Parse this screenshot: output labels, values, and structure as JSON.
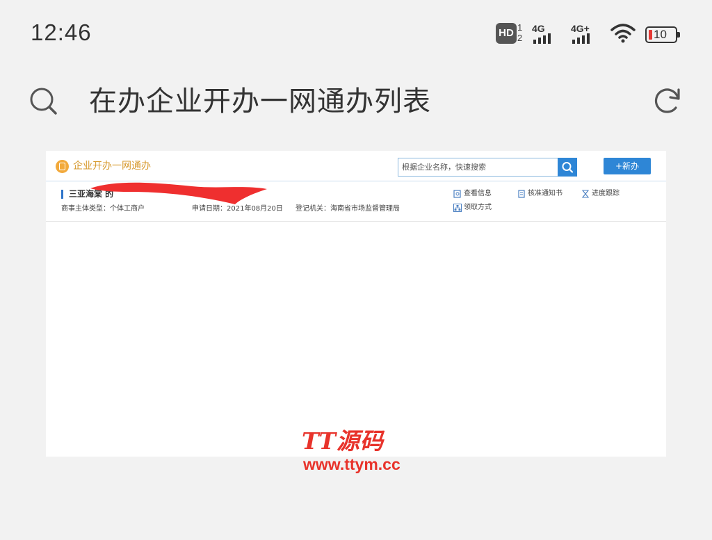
{
  "status_bar": {
    "time": "12:46",
    "hd_label": "HD",
    "hd_sim_top": "1",
    "hd_sim_bottom": "2",
    "sim1_label": "4G",
    "sim2_label": "4G+",
    "battery_level": "10",
    "battery_color": "#e53935"
  },
  "browser": {
    "title": "在办企业开办一网通办列表",
    "search_icon": "search-icon",
    "reload_icon": "reload-icon"
  },
  "webpage": {
    "logo_text": "企业开办一网通办",
    "search_placeholder": "根据企业名称，快速搜索",
    "new_button_label": "+新办",
    "accent_color": "#2e86d6",
    "record": {
      "company_name": "三亚海棠 的",
      "entity_type": "商事主体类型：个体工商户",
      "apply_date": "申请日期：2021年08月20日",
      "registry": "登记机关：海南省市场监督管理局",
      "actions": {
        "view_info": "查看信息",
        "approval_notice": "核准通知书",
        "progress": "进度跟踪",
        "pickup": "领取方式"
      }
    }
  },
  "watermark": {
    "title": "TT源码",
    "url": "www.ttym.cc"
  }
}
